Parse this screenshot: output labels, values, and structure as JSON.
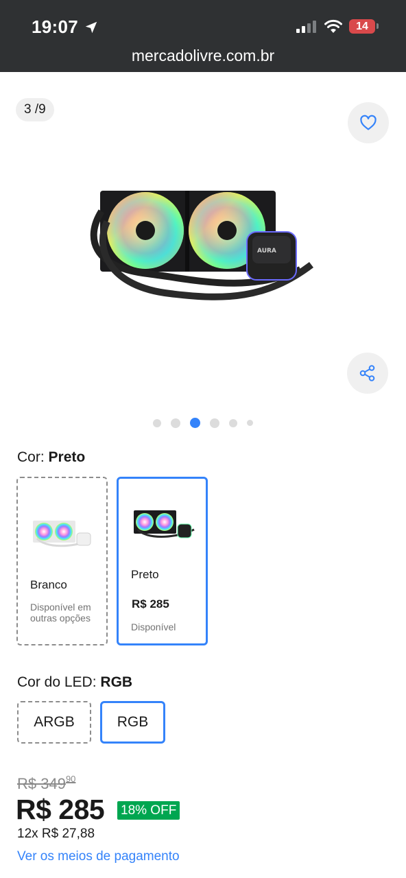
{
  "status_bar": {
    "time": "19:07",
    "battery": "14"
  },
  "browser": {
    "url": "mercadolivre.com.br"
  },
  "gallery": {
    "counter": "3 /9",
    "current_index": 3,
    "total": 9
  },
  "color_selector": {
    "label": "Cor:",
    "selected": "Preto",
    "options": [
      {
        "name": "Branco",
        "status": "Disponível em outras opções"
      },
      {
        "name": "Preto",
        "price": "R$ 285",
        "status": "Disponível"
      }
    ]
  },
  "led_selector": {
    "label": "Cor do LED:",
    "selected": "RGB",
    "options": [
      "ARGB",
      "RGB"
    ]
  },
  "pricing": {
    "old_price_whole": "R$ 349",
    "old_price_cents": "90",
    "price": "R$ 285",
    "discount": "18% OFF",
    "installments": "12x R$ 27,88",
    "payment_link": "Ver os meios de pagamento"
  },
  "colors": {
    "accent": "#3483fa",
    "discount_badge": "#00a650",
    "status_bar": "#2f3133"
  }
}
